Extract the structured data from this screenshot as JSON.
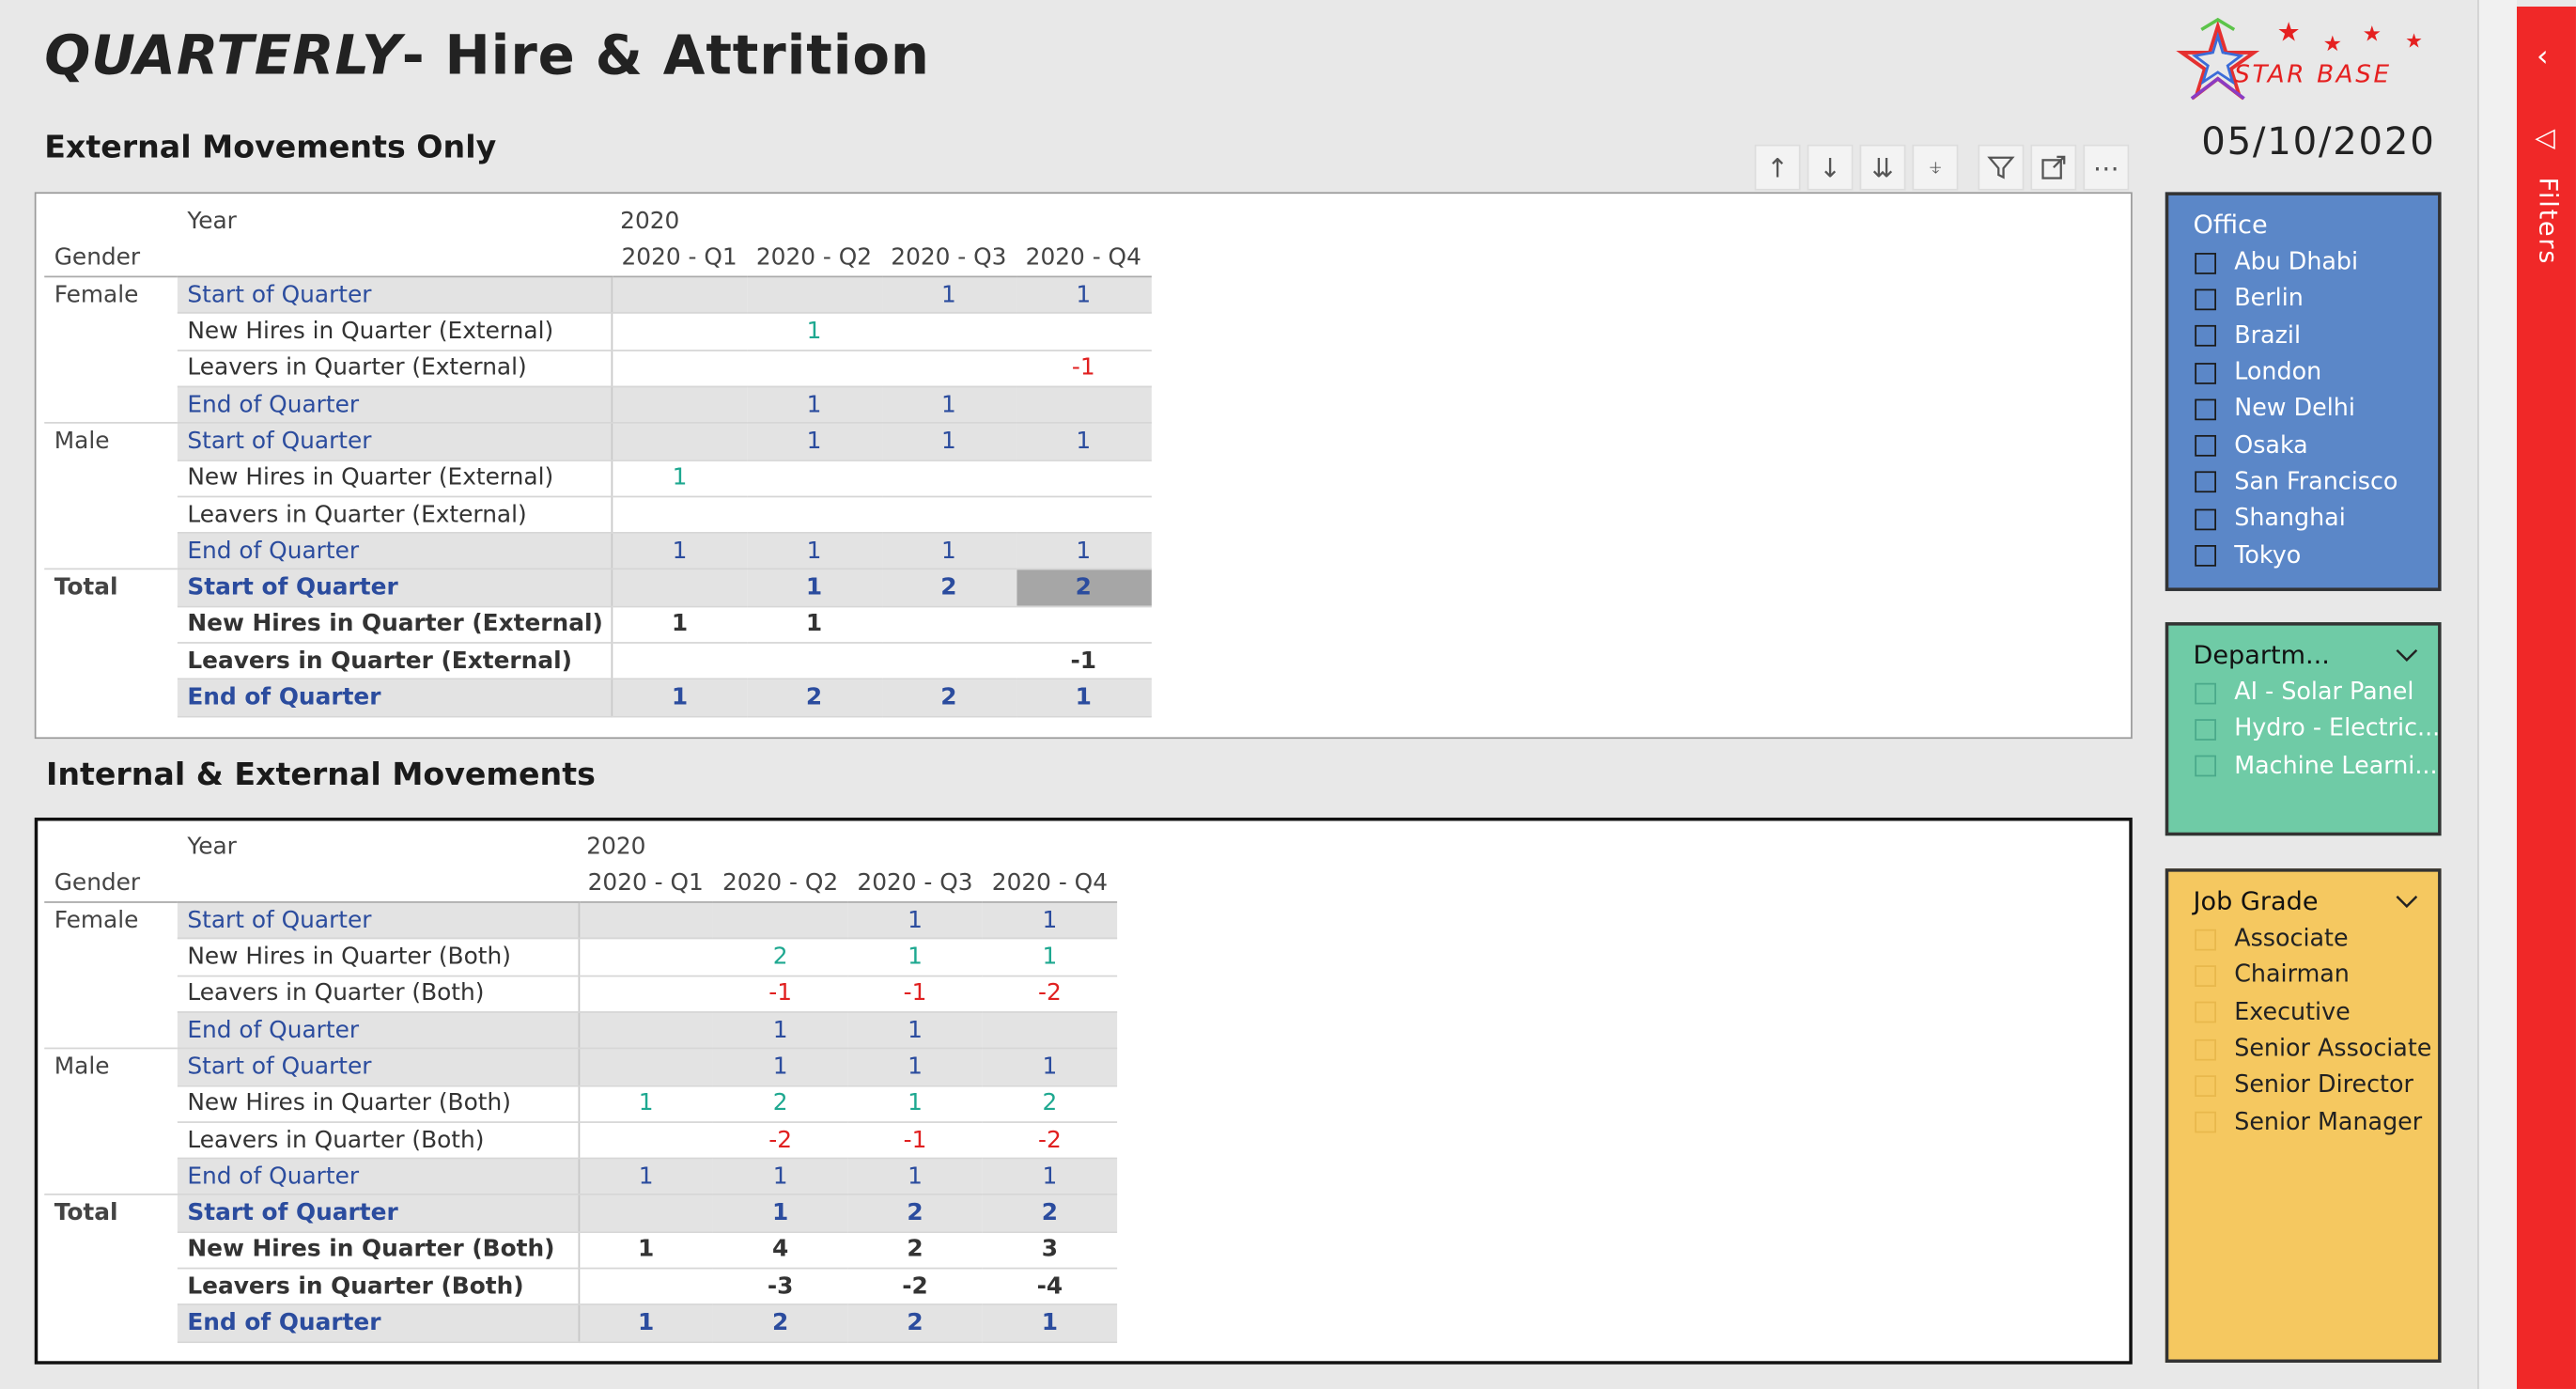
{
  "report": {
    "title_prefix": "QUARTERLY",
    "title_rest": "- Hire & Attrition",
    "date": "05/10/2020",
    "logo_text": "STAR BASE"
  },
  "toolbar": {
    "icons": [
      "arrow-up-icon",
      "arrow-down-icon",
      "double-arrow-down-icon",
      "expand-hierarchy-icon",
      "filter-icon",
      "focus-mode-icon",
      "more-options-icon"
    ]
  },
  "external": {
    "section_title": "External Movements Only",
    "hdr_year_label": "Year",
    "hdr_year": "2020",
    "hdr_gender_label": "Gender",
    "quarters": [
      "2020 - Q1",
      "2020 - Q2",
      "2020 - Q3",
      "2020 - Q4"
    ],
    "rows": [
      {
        "gender": "Female",
        "measure": "Start of Quarter",
        "values": [
          "",
          "",
          "1",
          "1"
        ]
      },
      {
        "gender": "",
        "measure": "New Hires in Quarter (External)",
        "values": [
          "",
          "1",
          "",
          ""
        ]
      },
      {
        "gender": "",
        "measure": "Leavers in Quarter (External)",
        "values": [
          "",
          "",
          "",
          "-1"
        ]
      },
      {
        "gender": "",
        "measure": "End of Quarter",
        "values": [
          "",
          "1",
          "1",
          ""
        ]
      },
      {
        "gender": "Male",
        "measure": "Start of Quarter",
        "values": [
          "",
          "1",
          "1",
          "1"
        ]
      },
      {
        "gender": "",
        "measure": "New Hires in Quarter (External)",
        "values": [
          "1",
          "",
          "",
          ""
        ]
      },
      {
        "gender": "",
        "measure": "Leavers in Quarter (External)",
        "values": [
          "",
          "",
          "",
          ""
        ]
      },
      {
        "gender": "",
        "measure": "End of Quarter",
        "values": [
          "1",
          "1",
          "1",
          "1"
        ]
      },
      {
        "gender": "Total",
        "measure": "Start of Quarter",
        "values": [
          "",
          "1",
          "2",
          "2"
        ]
      },
      {
        "gender": "",
        "measure": "New Hires in Quarter (External)",
        "values": [
          "1",
          "1",
          "",
          ""
        ]
      },
      {
        "gender": "",
        "measure": "Leavers in Quarter (External)",
        "values": [
          "",
          "",
          "",
          "-1"
        ]
      },
      {
        "gender": "",
        "measure": "End of Quarter",
        "values": [
          "1",
          "2",
          "2",
          "1"
        ]
      }
    ]
  },
  "internal": {
    "section_title": "Internal & External Movements",
    "hdr_year_label": "Year",
    "hdr_year": "2020",
    "hdr_gender_label": "Gender",
    "quarters": [
      "2020 - Q1",
      "2020 - Q2",
      "2020 - Q3",
      "2020 - Q4"
    ],
    "rows": [
      {
        "gender": "Female",
        "measure": "Start of Quarter",
        "values": [
          "",
          "",
          "1",
          "1"
        ]
      },
      {
        "gender": "",
        "measure": "New Hires in Quarter (Both)",
        "values": [
          "",
          "2",
          "1",
          "1"
        ]
      },
      {
        "gender": "",
        "measure": "Leavers in Quarter (Both)",
        "values": [
          "",
          "-1",
          "-1",
          "-2"
        ]
      },
      {
        "gender": "",
        "measure": "End of Quarter",
        "values": [
          "",
          "1",
          "1",
          ""
        ]
      },
      {
        "gender": "Male",
        "measure": "Start of Quarter",
        "values": [
          "",
          "1",
          "1",
          "1"
        ]
      },
      {
        "gender": "",
        "measure": "New Hires in Quarter (Both)",
        "values": [
          "1",
          "2",
          "1",
          "2"
        ]
      },
      {
        "gender": "",
        "measure": "Leavers in Quarter (Both)",
        "values": [
          "",
          "-2",
          "-1",
          "-2"
        ]
      },
      {
        "gender": "",
        "measure": "End of Quarter",
        "values": [
          "1",
          "1",
          "1",
          "1"
        ]
      },
      {
        "gender": "Total",
        "measure": "Start of Quarter",
        "values": [
          "",
          "1",
          "2",
          "2"
        ]
      },
      {
        "gender": "",
        "measure": "New Hires in Quarter (Both)",
        "values": [
          "1",
          "4",
          "2",
          "3"
        ]
      },
      {
        "gender": "",
        "measure": "Leavers in Quarter (Both)",
        "values": [
          "",
          "-3",
          "-2",
          "-4"
        ]
      },
      {
        "gender": "",
        "measure": "End of Quarter",
        "values": [
          "1",
          "2",
          "2",
          "1"
        ]
      }
    ]
  },
  "slicers": {
    "office": {
      "title": "Office",
      "items": [
        "Abu Dhabi",
        "Berlin",
        "Brazil",
        "London",
        "New Delhi",
        "Osaka",
        "San Francisco",
        "Shanghai",
        "Tokyo"
      ],
      "color": "#5b87c8"
    },
    "department": {
      "title": "Departm...",
      "items": [
        "AI - Solar Panel",
        "Hydro - Electric...",
        "Machine Learni..."
      ],
      "color": "#6fcba6"
    },
    "job_grade": {
      "title": "Job Grade",
      "items": [
        "Associate",
        "Chairman",
        "Executive",
        "Senior Associate",
        "Senior Director",
        "Senior Manager"
      ],
      "color": "#f5c860"
    }
  },
  "filters_pane": {
    "label": "Filters",
    "color": "#f02828"
  },
  "colors": {
    "measure_blue": "#2b4c9e",
    "positive_green": "#1ea890",
    "negative_red": "#e02020"
  }
}
